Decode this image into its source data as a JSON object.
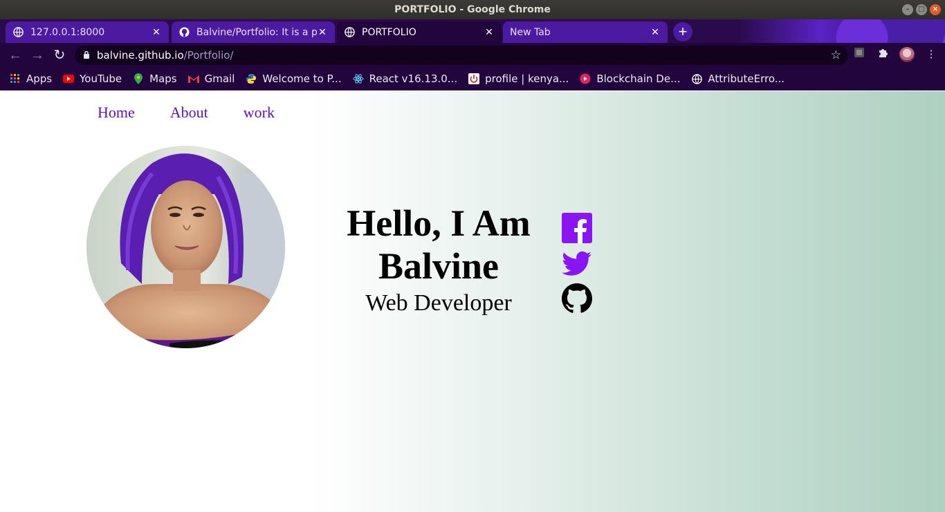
{
  "window": {
    "title": "PORTFOLIO - Google Chrome"
  },
  "tabs": [
    {
      "label": "127.0.0.1:8000",
      "icon": "globe-icon",
      "active": false
    },
    {
      "label": "Balvine/Portfolio: It is a p",
      "icon": "github-icon",
      "active": false
    },
    {
      "label": "PORTFOLIO",
      "icon": "globe-icon",
      "active": true
    },
    {
      "label": "New Tab",
      "icon": "",
      "active": false
    }
  ],
  "omnibox": {
    "host": "balvine.github.io",
    "path": "/Portfolio/"
  },
  "bookmarks": [
    {
      "label": "Apps",
      "icon": "apps-grid-icon",
      "color": "#e94235"
    },
    {
      "label": "YouTube",
      "icon": "youtube-icon",
      "color": "#ff0000"
    },
    {
      "label": "Maps",
      "icon": "maps-pin-icon",
      "color": "#34a853"
    },
    {
      "label": "Gmail",
      "icon": "gmail-icon",
      "color": "#ea4335"
    },
    {
      "label": "Welcome to P...",
      "icon": "python-icon",
      "color": "#3776ab"
    },
    {
      "label": "React v16.13.0...",
      "icon": "react-icon",
      "color": "#61dafb"
    },
    {
      "label": "profile | kenya...",
      "icon": "power-icon",
      "color": "#d32f2f"
    },
    {
      "label": "Blockchain De...",
      "icon": "play-circle-icon",
      "color": "#e91e63"
    },
    {
      "label": "AttributeErro...",
      "icon": "globe-icon",
      "color": "#ffffff"
    }
  ],
  "nav": {
    "home": "Home",
    "about": "About",
    "work": "work"
  },
  "hero": {
    "line1": "Hello, I Am",
    "line2": "Balvine",
    "role": "Web Developer"
  },
  "socials": [
    {
      "name": "facebook",
      "icon": "facebook-icon",
      "color": "#8a14f2"
    },
    {
      "name": "twitter",
      "icon": "twitter-icon",
      "color": "#8a14f2"
    },
    {
      "name": "github",
      "icon": "github-icon",
      "color": "#000000"
    }
  ],
  "colors": {
    "accent": "#5d0ec8",
    "social": "#8a14f2",
    "chrome_frame": "#22053d"
  }
}
